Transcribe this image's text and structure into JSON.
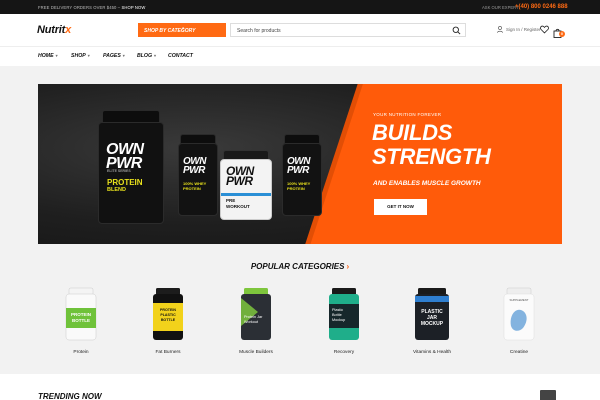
{
  "topbar": {
    "promo": "FREE DELIVERY ORDERS OVER $450 –",
    "promo_link": "SHOP NOW",
    "ask": "ASK OUR EXPERT",
    "phone": "+(40) 800 0246 888"
  },
  "header": {
    "logo_main": "Nutrit",
    "logo_x": "x",
    "category_button": "SHOP BY CATEGORY",
    "search_placeholder": "Search for products",
    "account": "Sign In / Register",
    "cart_count": "0"
  },
  "nav": [
    {
      "label": "HOME",
      "dropdown": true
    },
    {
      "label": "SHOP",
      "dropdown": true
    },
    {
      "label": "PAGES",
      "dropdown": true
    },
    {
      "label": "BLOG",
      "dropdown": true
    },
    {
      "label": "CONTACT",
      "dropdown": false
    }
  ],
  "hero": {
    "kicker": "YOUR NUTRITION FOREVER",
    "title_line1": "BUILDS",
    "title_line2": "STRENGTH",
    "subtitle": "AND ENABLES MUSCLE GROWTH",
    "button": "GET IT NOW",
    "products": [
      {
        "brand": "OWN PWR",
        "line": "ELITE SERIES",
        "name": "PROTEIN",
        "sub": "BLEND"
      },
      {
        "brand": "OWN PWR",
        "line": "",
        "name": "100% WHEY",
        "sub": "PROTEIN"
      },
      {
        "brand": "OWN PWR",
        "line": "",
        "name": "PRE",
        "sub": "WORKOUT"
      },
      {
        "brand": "OWN PWR",
        "line": "",
        "name": "100% WHEY",
        "sub": "PROTEIN"
      }
    ]
  },
  "categories": {
    "title": "POPULAR CATEGORIES",
    "items": [
      {
        "name": "Protein",
        "jar_text": "PROTEIN BOTTLE",
        "jar_color": "#6fc23a"
      },
      {
        "name": "Fat Burners",
        "jar_text": "PROTEIN PLASTIC BOTTLE",
        "jar_color": "#f2d21b"
      },
      {
        "name": "Muscle Builders",
        "jar_text": "Protein Jar Workout",
        "jar_color": "#7ec63d"
      },
      {
        "name": "Recovery",
        "jar_text": "Plastic Bottle Mockup",
        "jar_color": "#1fae8a"
      },
      {
        "name": "Vitamins & Health",
        "jar_text": "PLASTIC JAR MOCKUP",
        "jar_color": "#2f7fd0"
      },
      {
        "name": "Creatine",
        "jar_text": "SUPPLEMENT",
        "jar_color": "#5b9bd5"
      }
    ]
  },
  "trending": {
    "title": "TRENDING NOW"
  },
  "colors": {
    "accent": "#ff5b0a",
    "dark": "#151515"
  }
}
